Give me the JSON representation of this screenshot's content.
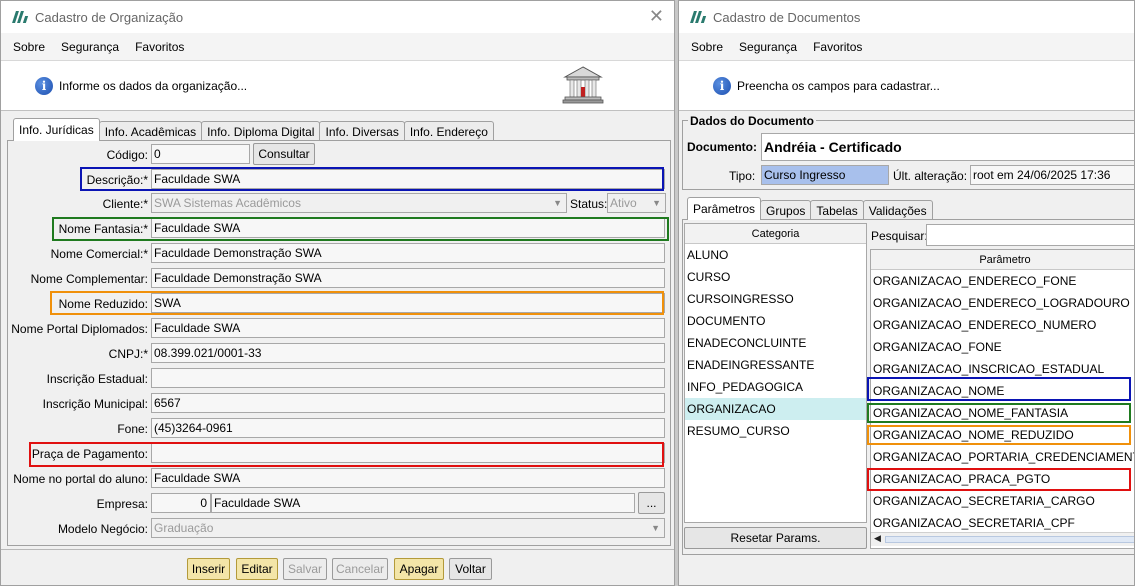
{
  "left_window": {
    "title": "Cadastro de Organização",
    "menu": [
      "Sobre",
      "Segurança",
      "Favoritos"
    ],
    "info_message": "Informe os dados da organização...",
    "tabs": [
      "Info. Jurídicas",
      "Info. Acadêmicas",
      "Info. Diploma Digital",
      "Info. Diversas",
      "Info. Endereço"
    ],
    "fields": {
      "codigo": {
        "label": "Código:",
        "value": "0"
      },
      "consultar": "Consultar",
      "descricao": {
        "label": "Descrição:*",
        "value": "Faculdade SWA"
      },
      "cliente": {
        "label": "Cliente:*",
        "value": "SWA Sistemas Acadêmicos"
      },
      "status": {
        "label": "Status:",
        "value": "Ativo"
      },
      "nome_fantasia": {
        "label": "Nome Fantasia:*",
        "value": "Faculdade SWA"
      },
      "nome_comercial": {
        "label": "Nome Comercial:*",
        "value": "Faculdade Demonstração SWA"
      },
      "nome_complementar": {
        "label": "Nome Complementar:",
        "value": "Faculdade Demonstração SWA"
      },
      "nome_reduzido": {
        "label": "Nome Reduzido:",
        "value": "SWA"
      },
      "nome_portal_diplomados": {
        "label": "Nome Portal Diplomados:",
        "value": "Faculdade SWA"
      },
      "cnpj": {
        "label": "CNPJ:*",
        "value": "08.399.021/0001-33"
      },
      "inscricao_estadual": {
        "label": "Inscrição Estadual:",
        "value": ""
      },
      "inscricao_municipal": {
        "label": "Inscrição Municipal:",
        "value": "6567"
      },
      "fone": {
        "label": "Fone:",
        "value": "(45)3264-0961"
      },
      "praca_pagamento": {
        "label": "Praça de Pagamento:",
        "value": ""
      },
      "nome_portal_aluno": {
        "label": "Nome no portal do aluno:",
        "value": "Faculdade SWA"
      },
      "empresa": {
        "label": "Empresa:",
        "code": "0",
        "value": "Faculdade SWA",
        "btn": "..."
      },
      "modelo_negocio": {
        "label": "Modelo Negócio:",
        "value": "Graduação"
      }
    },
    "buttons": [
      "Inserir",
      "Editar",
      "Salvar",
      "Cancelar",
      "Apagar",
      "Voltar"
    ]
  },
  "right_window": {
    "title": "Cadastro de Documentos",
    "menu": [
      "Sobre",
      "Segurança",
      "Favoritos"
    ],
    "info_message": "Preencha os campos para cadastrar...",
    "group_title": "Dados do Documento",
    "documento": {
      "label": "Documento:",
      "value": "Andréia - Certificado"
    },
    "tipo": {
      "label": "Tipo:",
      "value": "Curso Ingresso"
    },
    "ult_alteracao": {
      "label": "Últ. alteração:",
      "value": "root em 24/06/2025 17:36"
    },
    "tabs": [
      "Parâmetros",
      "Grupos",
      "Tabelas",
      "Validações"
    ],
    "categoria_header": "Categoria",
    "categorias": [
      "ALUNO",
      "CURSO",
      "CURSOINGRESSO",
      "DOCUMENTO",
      "ENADECONCLUINTE",
      "ENADEINGRESSANTE",
      "INFO_PEDAGOGICA",
      "ORGANIZACAO",
      "RESUMO_CURSO"
    ],
    "selected_categoria": "ORGANIZACAO",
    "resetar": "Resetar Params.",
    "pesquisar_label": "Pesquisar:",
    "parametro_header": "Parâmetro",
    "parametros": [
      "ORGANIZACAO_ENDERECO_FONE",
      "ORGANIZACAO_ENDERECO_LOGRADOURO",
      "ORGANIZACAO_ENDERECO_NUMERO",
      "ORGANIZACAO_FONE",
      "ORGANIZACAO_INSCRICAO_ESTADUAL",
      "ORGANIZACAO_NOME",
      "ORGANIZACAO_NOME_FANTASIA",
      "ORGANIZACAO_NOME_REDUZIDO",
      "ORGANIZACAO_PORTARIA_CREDENCIAMENTO",
      "ORGANIZACAO_PRACA_PGTO",
      "ORGANIZACAO_SECRETARIA_CARGO",
      "ORGANIZACAO_SECRETARIA_CPF"
    ]
  },
  "colors": {
    "highlight_blue": "#0a14b4",
    "highlight_green": "#1f7a1f",
    "highlight_orange": "#f0900a",
    "highlight_red": "#e01010",
    "tipo_bg": "#a8c0ec",
    "selected_row": "#cdeef0"
  }
}
